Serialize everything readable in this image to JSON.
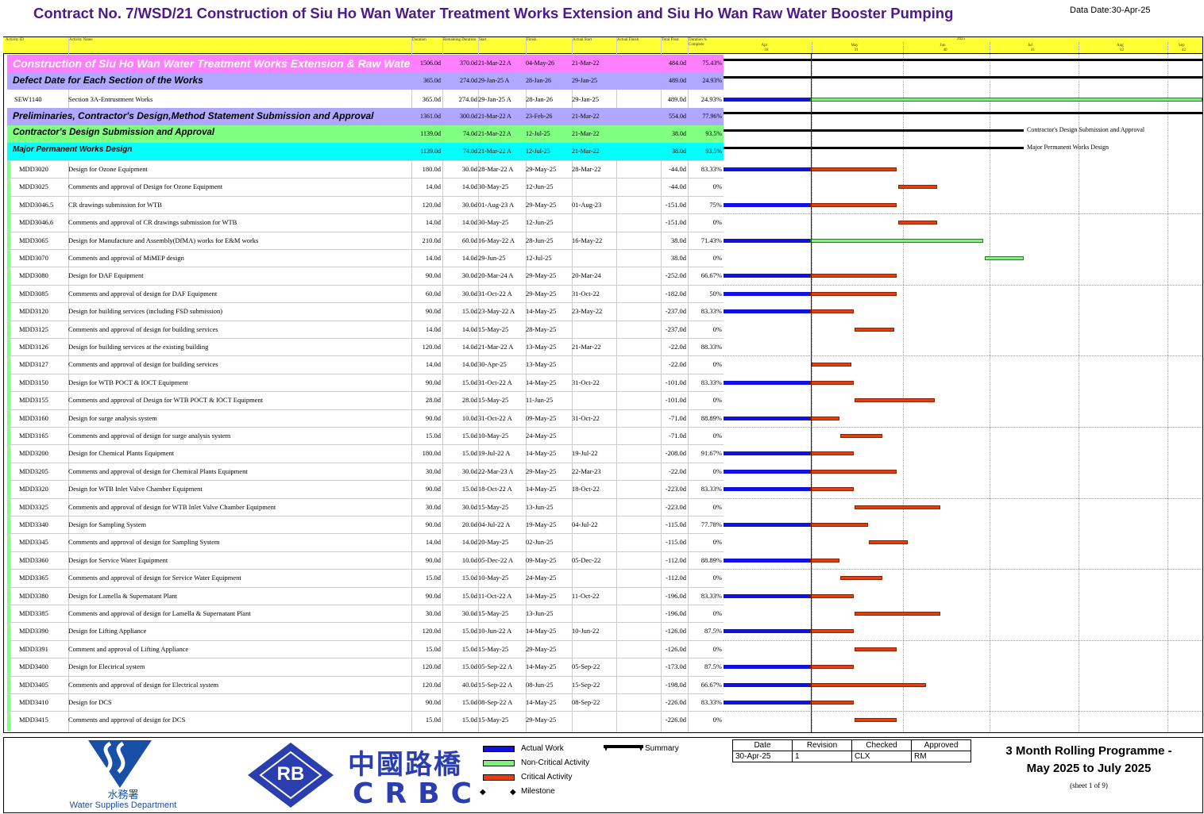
{
  "header": {
    "title": "Contract No. 7/WSD/21 Construction of Siu Ho Wan Water Treatment Works Extension and Siu Ho Wan Raw Water Booster Pumping",
    "data_date": "Data Date:30-Apr-25"
  },
  "columns": [
    "Activity ID",
    "Activity Name",
    "Duration",
    "Remaining Duration",
    "Start",
    "Finish",
    "Actual Start",
    "Actual Finish",
    "Total Float",
    "Duration % Complete"
  ],
  "timeline": {
    "year": "2025",
    "months": [
      "Apr",
      "May",
      "Jun",
      "Jul",
      "Aug",
      "Sep"
    ],
    "weeks": [
      "18",
      "31",
      "40",
      "41",
      "42",
      "42"
    ]
  },
  "bands": [
    {
      "name": "Construction of Siu Ho Wan Water Treatment Works Extension & Raw Water Bo",
      "dur": "1506.0d",
      "rem": "370.0d",
      "start": "21-Mar-22 A",
      "finish": "04-May-26",
      "astart": "21-Mar-22",
      "float": "484.0d",
      "pct": "75.43%",
      "color": "#ff80ff",
      "text_color": "#ffffff"
    },
    {
      "name": "Defect Date for Each Section of the Works",
      "dur": "365.0d",
      "rem": "274.0d",
      "start": "29-Jan-25 A",
      "finish": "28-Jan-26",
      "astart": "29-Jan-25",
      "float": "489.0d",
      "pct": "24.93%",
      "color": "#b0a8ff",
      "text_color": "#000000"
    },
    {
      "name": "Preliminaries, Contractor's Design,Method Statement Submission and Approval",
      "dur": "1361.0d",
      "rem": "300.0d",
      "start": "21-Mar-22 A",
      "finish": "23-Feb-26",
      "astart": "21-Mar-22",
      "float": "554.0d",
      "pct": "77.96%",
      "color": "#b0a8ff",
      "text_color": "#000000"
    },
    {
      "name": "Contractor's Design Submission and Approval",
      "dur": "1139.0d",
      "rem": "74.0d",
      "start": "21-Mar-22 A",
      "finish": "12-Jul-25",
      "astart": "21-Mar-22",
      "float": "38.0d",
      "pct": "93.5%",
      "color": "#80ff80",
      "text_color": "#000000"
    },
    {
      "name": "Major Permanent Works Design",
      "dur": "1139.0d",
      "rem": "74.0d",
      "start": "21-Mar-22 A",
      "finish": "12-Jul-25",
      "astart": "21-Mar-22",
      "float": "38.0d",
      "pct": "93.5%",
      "color": "#00ffff",
      "text_color": "#000000"
    }
  ],
  "summary_labels": [
    "Contractor's Design Submission and Approval",
    "Major Permanent Works Design"
  ],
  "activities": [
    {
      "id": "SEW1140",
      "name": "Section 3A-Entrustment Works",
      "dur": "365.0d",
      "rem": "274.0d",
      "start": "29-Jan-25 A",
      "finish": "28-Jan-26",
      "astart": "29-Jan-25",
      "float": "489.0d",
      "pct": "24.93%",
      "actual": [
        0,
        109
      ],
      "remaining": [
        109,
        603
      ],
      "rem_type": "noncritical"
    },
    {
      "id": "MDD3020",
      "name": "Design for Ozone Equipment",
      "dur": "180.0d",
      "rem": "30.0d",
      "start": "28-Mar-22 A",
      "finish": "29-May-25",
      "astart": "28-Mar-22",
      "float": "-44.0d",
      "pct": "83.33%",
      "actual": [
        0,
        109
      ],
      "remaining": [
        109,
        218
      ],
      "rem_type": "critical"
    },
    {
      "id": "MDD3025",
      "name": "Comments and approval of Design for Ozone Equipment",
      "dur": "14.0d",
      "rem": "14.0d",
      "start": "30-May-25",
      "finish": "12-Jun-25",
      "astart": "",
      "float": "-44.0d",
      "pct": "0%",
      "actual": null,
      "remaining": [
        220,
        269
      ],
      "rem_type": "critical"
    },
    {
      "id": "MDD3046.5",
      "name": "CR drawings submission for WTB",
      "dur": "120.0d",
      "rem": "30.0d",
      "start": "01-Aug-23 A",
      "finish": "29-May-25",
      "astart": "01-Aug-23",
      "float": "-151.0d",
      "pct": "75%",
      "actual": [
        0,
        109
      ],
      "remaining": [
        109,
        218
      ],
      "rem_type": "critical"
    },
    {
      "id": "MDD3046.6",
      "name": "Comments and approval of CR drawings submission for WTB",
      "dur": "14.0d",
      "rem": "14.0d",
      "start": "30-May-25",
      "finish": "12-Jun-25",
      "astart": "",
      "float": "-151.0d",
      "pct": "0%",
      "actual": null,
      "remaining": [
        220,
        269
      ],
      "rem_type": "critical"
    },
    {
      "id": "MDD3065",
      "name": "Design for Manufacture and Assembly(DfMA) works for E&M works",
      "dur": "210.0d",
      "rem": "60.0d",
      "start": "16-May-22 A",
      "finish": "28-Jun-25",
      "astart": "16-May-22",
      "float": "38.0d",
      "pct": "71.43%",
      "actual": [
        0,
        109
      ],
      "remaining": [
        109,
        327
      ],
      "rem_type": "noncritical"
    },
    {
      "id": "MDD3070",
      "name": "Comments and approval of MiMEP design",
      "dur": "14.0d",
      "rem": "14.0d",
      "start": "29-Jun-25",
      "finish": "12-Jul-25",
      "astart": "",
      "float": "38.0d",
      "pct": "0%",
      "actual": null,
      "remaining": [
        329,
        378
      ],
      "rem_type": "noncritical"
    },
    {
      "id": "MDD3080",
      "name": "Design for DAF Equipment",
      "dur": "90.0d",
      "rem": "30.0d",
      "start": "20-Mar-24 A",
      "finish": "29-May-25",
      "astart": "20-Mar-24",
      "float": "-252.0d",
      "pct": "66.67%",
      "actual": [
        0,
        109
      ],
      "remaining": [
        109,
        218
      ],
      "rem_type": "critical"
    },
    {
      "id": "MDD3085",
      "name": "Comments and approval of design for DAF Equipment",
      "dur": "60.0d",
      "rem": "30.0d",
      "start": "31-Oct-22 A",
      "finish": "29-May-25",
      "astart": "31-Oct-22",
      "float": "-182.0d",
      "pct": "50%",
      "actual": [
        0,
        109
      ],
      "remaining": [
        109,
        218
      ],
      "rem_type": "critical"
    },
    {
      "id": "MDD3120",
      "name": "Design for building services (including FSD submission)",
      "dur": "90.0d",
      "rem": "15.0d",
      "start": "23-May-22 A",
      "finish": "14-May-25",
      "astart": "23-May-22",
      "float": "-237.0d",
      "pct": "83.33%",
      "actual": [
        0,
        109
      ],
      "remaining": [
        109,
        164
      ],
      "rem_type": "critical"
    },
    {
      "id": "MDD3125",
      "name": "Comments and approval of design for building services",
      "dur": "14.0d",
      "rem": "14.0d",
      "start": "15-May-25",
      "finish": "28-May-25",
      "astart": "",
      "float": "-237.0d",
      "pct": "0%",
      "actual": null,
      "remaining": [
        165,
        215
      ],
      "rem_type": "critical"
    },
    {
      "id": "MDD3126",
      "name": "Design for building services at the existing building",
      "dur": "120.0d",
      "rem": "14.0d",
      "start": "21-Mar-22 A",
      "finish": "13-May-25",
      "astart": "21-Mar-22",
      "float": "-22.0d",
      "pct": "88.33%",
      "actual": null,
      "remaining": null,
      "rem_type": "critical"
    },
    {
      "id": "MDD3127",
      "name": "Comments and approval of design for building services",
      "dur": "14.0d",
      "rem": "14.0d",
      "start": "30-Apr-25",
      "finish": "13-May-25",
      "astart": "",
      "float": "-22.0d",
      "pct": "0%",
      "actual": null,
      "remaining": [
        111,
        161
      ],
      "rem_type": "critical"
    },
    {
      "id": "MDD3150",
      "name": "Design for WTB POCT & IOCT Equipment",
      "dur": "90.0d",
      "rem": "15.0d",
      "start": "31-Oct-22 A",
      "finish": "14-May-25",
      "astart": "31-Oct-22",
      "float": "-101.0d",
      "pct": "83.33%",
      "actual": [
        0,
        109
      ],
      "remaining": [
        109,
        164
      ],
      "rem_type": "critical"
    },
    {
      "id": "MDD3155",
      "name": "Comments and approval of Design for WTB POCT & IOCT Equipment",
      "dur": "28.0d",
      "rem": "28.0d",
      "start": "15-May-25",
      "finish": "11-Jun-25",
      "astart": "",
      "float": "-101.0d",
      "pct": "0%",
      "actual": null,
      "remaining": [
        165,
        266
      ],
      "rem_type": "critical"
    },
    {
      "id": "MDD3160",
      "name": "Design for surge analysis system",
      "dur": "90.0d",
      "rem": "10.0d",
      "start": "31-Oct-22 A",
      "finish": "09-May-25",
      "astart": "31-Oct-22",
      "float": "-71.0d",
      "pct": "88.89%",
      "actual": [
        0,
        109
      ],
      "remaining": [
        109,
        146
      ],
      "rem_type": "critical"
    },
    {
      "id": "MDD3165",
      "name": "Comments and approval of design for surge analysis system",
      "dur": "15.0d",
      "rem": "15.0d",
      "start": "10-May-25",
      "finish": "24-May-25",
      "astart": "",
      "float": "-71.0d",
      "pct": "0%",
      "actual": null,
      "remaining": [
        147,
        200
      ],
      "rem_type": "critical"
    },
    {
      "id": "MDD3200",
      "name": "Design for Chemical Plants Equipment",
      "dur": "180.0d",
      "rem": "15.0d",
      "start": "19-Jul-22 A",
      "finish": "14-May-25",
      "astart": "19-Jul-22",
      "float": "-208.0d",
      "pct": "91.67%",
      "actual": [
        0,
        109
      ],
      "remaining": [
        109,
        164
      ],
      "rem_type": "critical"
    },
    {
      "id": "MDD3205",
      "name": "Comments and approval of design for Chemical Plants Equipment",
      "dur": "30.0d",
      "rem": "30.0d",
      "start": "22-Mar-23 A",
      "finish": "29-May-25",
      "astart": "22-Mar-23",
      "float": "-22.0d",
      "pct": "0%",
      "actual": [
        0,
        109
      ],
      "remaining": [
        109,
        218
      ],
      "rem_type": "critical"
    },
    {
      "id": "MDD3320",
      "name": "Design for WTB Inlet Valve Chamber Equipment",
      "dur": "90.0d",
      "rem": "15.0d",
      "start": "18-Oct-22 A",
      "finish": "14-May-25",
      "astart": "18-Oct-22",
      "float": "-223.0d",
      "pct": "83.33%",
      "actual": [
        0,
        109
      ],
      "remaining": [
        109,
        164
      ],
      "rem_type": "critical"
    },
    {
      "id": "MDD3325",
      "name": "Comments and approval of design for WTB Inlet Valve Chamber Equipment",
      "dur": "30.0d",
      "rem": "30.0d",
      "start": "15-May-25",
      "finish": "13-Jun-25",
      "astart": "",
      "float": "-223.0d",
      "pct": "0%",
      "actual": null,
      "remaining": [
        165,
        273
      ],
      "rem_type": "critical"
    },
    {
      "id": "MDD3340",
      "name": "Design for Sampling System",
      "dur": "90.0d",
      "rem": "20.0d",
      "start": "04-Jul-22 A",
      "finish": "19-May-25",
      "astart": "04-Jul-22",
      "float": "-115.0d",
      "pct": "77.78%",
      "actual": [
        0,
        109
      ],
      "remaining": [
        109,
        182
      ],
      "rem_type": "critical"
    },
    {
      "id": "MDD3345",
      "name": "Comments and approval of design for Sampling System",
      "dur": "14.0d",
      "rem": "14.0d",
      "start": "20-May-25",
      "finish": "02-Jun-25",
      "astart": "",
      "float": "-115.0d",
      "pct": "0%",
      "actual": null,
      "remaining": [
        183,
        232
      ],
      "rem_type": "critical"
    },
    {
      "id": "MDD3360",
      "name": "Design for Service Water Equipment",
      "dur": "90.0d",
      "rem": "10.0d",
      "start": "05-Dec-22 A",
      "finish": "09-May-25",
      "astart": "05-Dec-22",
      "float": "-112.0d",
      "pct": "88.89%",
      "actual": [
        0,
        109
      ],
      "remaining": [
        109,
        146
      ],
      "rem_type": "critical"
    },
    {
      "id": "MDD3365",
      "name": "Comments and approval of design for Service Water Equipment",
      "dur": "15.0d",
      "rem": "15.0d",
      "start": "10-May-25",
      "finish": "24-May-25",
      "astart": "",
      "float": "-112.0d",
      "pct": "0%",
      "actual": null,
      "remaining": [
        147,
        200
      ],
      "rem_type": "critical"
    },
    {
      "id": "MDD3380",
      "name": "Design for Lamella & Supernatant Plant",
      "dur": "90.0d",
      "rem": "15.0d",
      "start": "11-Oct-22 A",
      "finish": "14-May-25",
      "astart": "11-Oct-22",
      "float": "-196.0d",
      "pct": "83.33%",
      "actual": [
        0,
        109
      ],
      "remaining": [
        109,
        164
      ],
      "rem_type": "critical"
    },
    {
      "id": "MDD3385",
      "name": "Comments and approval of design for Lamella & Supernatant Plant",
      "dur": "30.0d",
      "rem": "30.0d",
      "start": "15-May-25",
      "finish": "13-Jun-25",
      "astart": "",
      "float": "-196.0d",
      "pct": "0%",
      "actual": null,
      "remaining": [
        165,
        273
      ],
      "rem_type": "critical"
    },
    {
      "id": "MDD3390",
      "name": "Design for Lifting Appliance",
      "dur": "120.0d",
      "rem": "15.0d",
      "start": "10-Jun-22 A",
      "finish": "14-May-25",
      "astart": "10-Jun-22",
      "float": "-126.0d",
      "pct": "87.5%",
      "actual": [
        0,
        109
      ],
      "remaining": [
        109,
        164
      ],
      "rem_type": "critical"
    },
    {
      "id": "MDD3391",
      "name": "Comment and approval of Lifting Appliance",
      "dur": "15.0d",
      "rem": "15.0d",
      "start": "15-May-25",
      "finish": "29-May-25",
      "astart": "",
      "float": "-126.0d",
      "pct": "0%",
      "actual": null,
      "remaining": [
        165,
        218
      ],
      "rem_type": "critical"
    },
    {
      "id": "MDD3400",
      "name": "Design for Electrical system",
      "dur": "120.0d",
      "rem": "15.0d",
      "start": "05-Sep-22 A",
      "finish": "14-May-25",
      "astart": "05-Sep-22",
      "float": "-173.0d",
      "pct": "87.5%",
      "actual": [
        0,
        109
      ],
      "remaining": [
        109,
        164
      ],
      "rem_type": "critical"
    },
    {
      "id": "MDD3405",
      "name": "Comments and approval of design for Electrical system",
      "dur": "120.0d",
      "rem": "40.0d",
      "start": "15-Sep-22 A",
      "finish": "08-Jun-25",
      "astart": "15-Sep-22",
      "float": "-198.0d",
      "pct": "66.67%",
      "actual": [
        0,
        109
      ],
      "remaining": [
        109,
        255
      ],
      "rem_type": "critical"
    },
    {
      "id": "MDD3410",
      "name": "Design for DCS",
      "dur": "90.0d",
      "rem": "15.0d",
      "start": "08-Sep-22 A",
      "finish": "14-May-25",
      "astart": "08-Sep-22",
      "float": "-226.0d",
      "pct": "83.33%",
      "actual": [
        0,
        109
      ],
      "remaining": [
        109,
        164
      ],
      "rem_type": "critical"
    },
    {
      "id": "MDD3415",
      "name": "Comments and approval of design for DCS",
      "dur": "15.0d",
      "rem": "15.0d",
      "start": "15-May-25",
      "finish": "29-May-25",
      "astart": "",
      "float": "-226.0d",
      "pct": "0%",
      "actual": null,
      "remaining": [
        165,
        218
      ],
      "rem_type": "critical"
    }
  ],
  "legend": {
    "actual": "Actual Work",
    "noncritical": "Non-Critical Activity",
    "critical": "Critical Activity",
    "milestone": "Milestone",
    "summary": "Summary"
  },
  "signoff": {
    "headers": [
      "Date",
      "Revision",
      "Checked",
      "Approved"
    ],
    "values": [
      "30-Apr-25",
      "1",
      "CLX",
      "RM"
    ]
  },
  "programme": {
    "line1": "3 Month Rolling Programme -",
    "line2": "May 2025 to July 2025",
    "sheet": "(sheet 1 of 9)"
  },
  "logos": {
    "wsd_chinese": "水務署",
    "wsd_english": "Water Supplies Department",
    "rb": "RB",
    "crbc_chinese": "中國路橋",
    "crbc_english": "CRBC"
  },
  "colors": {
    "actual": "#1010e0",
    "noncritical": "#80f080",
    "critical": "#e04010",
    "summary": "#000000",
    "title": "#4b1a8c",
    "header": "#ffff33",
    "logo_blue": "#1a4fa8",
    "crbc_blue": "#2a3eb0"
  }
}
